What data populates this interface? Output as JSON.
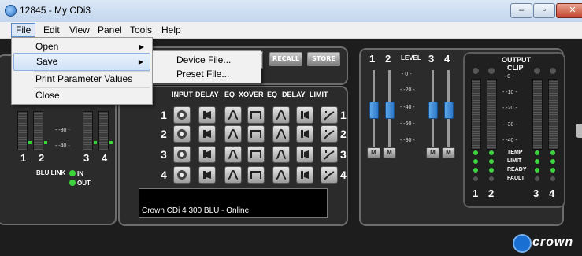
{
  "window": {
    "title": "12845 - My CDi3",
    "min": "‒",
    "max": "▫",
    "close": "✕"
  },
  "menubar": {
    "items": [
      {
        "label": "File",
        "id": "file"
      },
      {
        "label": "Edit",
        "id": "edit"
      },
      {
        "label": "View",
        "id": "view"
      },
      {
        "label": "Panel",
        "id": "panel"
      },
      {
        "label": "Tools",
        "id": "tools"
      },
      {
        "label": "Help",
        "id": "help"
      }
    ]
  },
  "file_menu": {
    "items": [
      {
        "label": "Open",
        "submenu": "▶"
      },
      {
        "label": "Save",
        "submenu": "▶"
      },
      {
        "label": "Print Parameter Values"
      },
      {
        "label": "Close"
      }
    ]
  },
  "save_submenu": {
    "items": [
      {
        "label": "Device File..."
      },
      {
        "label": "Preset File..."
      }
    ]
  },
  "presets": {
    "recall": "RECALL",
    "store": "STORE"
  },
  "left_panel": {
    "channels": [
      "1",
      "2",
      "3",
      "4"
    ],
    "scale": [
      "- -30 -",
      "- -40 -"
    ],
    "blu_link": "BLU LINK",
    "in": "IN",
    "out": "OUT"
  },
  "dsp": {
    "headers": [
      "INPUT",
      "DELAY",
      "EQ",
      "XOVER",
      "EQ",
      "DELAY",
      "LIMIT"
    ],
    "rows": [
      "1",
      "2",
      "3",
      "4"
    ],
    "status": "Crown CDi 4 300 BLU - Online"
  },
  "level": {
    "label": "LEVEL",
    "channels": [
      "1",
      "2",
      "3",
      "4"
    ],
    "scale": [
      "- 0 -",
      "- -20 -",
      "- -40 -",
      "- -60 -",
      "- -80 -"
    ],
    "mute": "M"
  },
  "output": {
    "title": "OUTPUT",
    "clip": "CLIP",
    "scale": [
      "- 0 -",
      "- -10 -",
      "- -20 -",
      "- -30 -",
      "- -40 -"
    ],
    "labels": [
      "TEMP",
      "LIMIT",
      "READY",
      "FAULT"
    ],
    "channels": [
      "1",
      "2",
      "3",
      "4"
    ]
  },
  "brand": "crown"
}
